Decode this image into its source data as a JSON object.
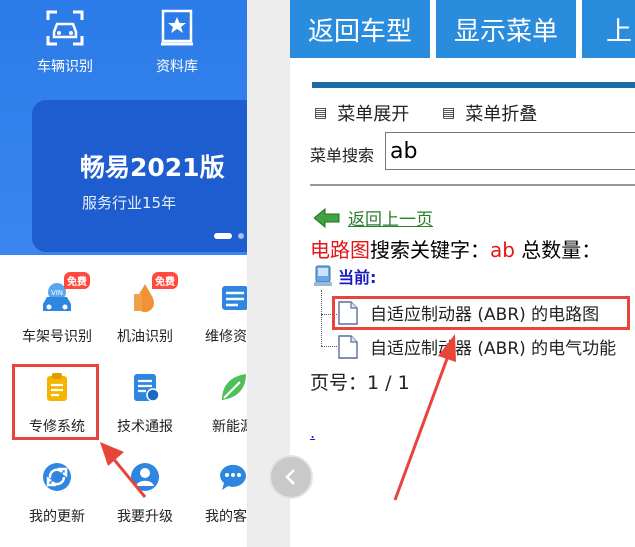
{
  "left_panel": {
    "top_icons": [
      {
        "label": "车辆识别",
        "icon": "car-scan-icon"
      },
      {
        "label": "资料库",
        "icon": "star-book-icon"
      }
    ],
    "banner": {
      "title": "畅易2021版",
      "subtitle": "服务行业15年"
    },
    "grid": [
      {
        "label": "车架号识别",
        "icon": "car-vin-icon",
        "badge": "免费"
      },
      {
        "label": "机油识别",
        "icon": "oil-drop-icon",
        "badge": "免费"
      },
      {
        "label": "维修资料",
        "icon": "repair-doc-icon"
      },
      {
        "label": "专修系统",
        "icon": "clipboard-icon"
      },
      {
        "label": "技术通报",
        "icon": "tech-report-icon"
      },
      {
        "label": "新能源",
        "icon": "leaf-icon"
      },
      {
        "label": "我的更新",
        "icon": "refresh-icon"
      },
      {
        "label": "我要升级",
        "icon": "user-upgrade-icon"
      },
      {
        "label": "我的客服",
        "icon": "chat-icon"
      }
    ]
  },
  "toolbar": {
    "back_model": "返回车型",
    "show_menu": "显示菜单",
    "up": "上"
  },
  "menu": {
    "expand": "菜单展开",
    "collapse": "菜单折叠",
    "search_label": "菜单搜索",
    "search_value": "ab"
  },
  "results": {
    "back_link": "返回上一页",
    "circuit_label": "电路图",
    "kw_prefix": "搜索关键字：",
    "keyword": "ab",
    "total_label": " 总数量：",
    "current_label": "当前:",
    "items": [
      "自适应制动器 (ABR) 的电路图",
      "自适应制动器 (ABR) 的电气功能"
    ],
    "page_no": "页号：1 / 1",
    "dot_link": "."
  },
  "colors": {
    "toolbar_blue": "#2a8cdc",
    "header_blue": "#2b7be8",
    "highlight_red": "#e8443a",
    "keyword_red": "#e01818",
    "link_green": "#2a7d2a"
  }
}
